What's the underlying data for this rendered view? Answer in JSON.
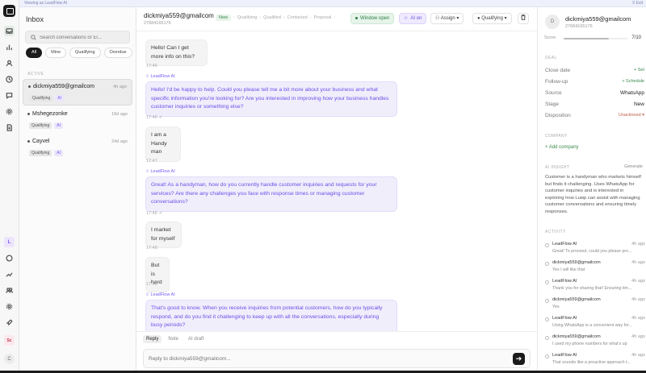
{
  "topbar": {
    "left": "Viewing as LeadFlow AI",
    "right": "X Exit"
  },
  "rail": {
    "icons": [
      "inbox-icon",
      "chart-icon",
      "users-icon",
      "clock-icon",
      "message-icon",
      "settings-icon",
      "document-icon"
    ],
    "l_badge": "L",
    "sc_badge": "Sc",
    "c_badge": "C"
  },
  "inbox": {
    "title": "Inbox",
    "search_placeholder": "Search conversations or El...",
    "filters": [
      "All",
      "Mine",
      "Qualifying",
      "Overdue"
    ],
    "section": "ACTIVE",
    "conversations": [
      {
        "name": "dickmiya559@gmailcom",
        "time": "4h ago",
        "stage": "Qualifying",
        "ai": "AI"
      },
      {
        "name": "Mshegezonke",
        "time": "18d ago",
        "stage": "Qualifying",
        "ai": "AI"
      },
      {
        "name": "Cayvel",
        "time": "24d ago",
        "stage": "Qualifying",
        "ai": "AI"
      }
    ]
  },
  "chat": {
    "email": "dickmiya559@gmailcom",
    "phone": "27684165176",
    "pipeline": [
      "New",
      "Qualifying",
      "Qualified",
      "Contacted",
      "Proposal"
    ],
    "window": "Window open",
    "ai": "AI on",
    "assign": "Assign",
    "status": "Qualifying",
    "messages": [
      {
        "dir": "in",
        "text": "Hello! Can I get more info on this?",
        "time": "17:46"
      },
      {
        "dir": "out",
        "bot": "LeadFlow AI",
        "text": "Hello! I'd be happy to help. Could you please tell me a bit more about your business and what specific information you're looking for? Are you interested in improving how your business handles customer inquiries or something else?",
        "time": "17:46"
      },
      {
        "dir": "in",
        "text": "I am a Handy man",
        "time": "17:47"
      },
      {
        "dir": "out",
        "bot": "LeadFlow AI",
        "text": "Great! As a handyman, how do you currently handle customer inquiries and requests for your services? Are there any challenges you face with response times or managing customer conversations?",
        "time": "17:48"
      },
      {
        "dir": "in",
        "text": "I market for myself",
        "time": "17:48"
      },
      {
        "dir": "in",
        "text": "But is hard",
        "time": "17:48"
      },
      {
        "dir": "out",
        "bot": "LeadFlow AI",
        "text": "That's good to know. When you receive inquiries from potential customers, how do you typically respond, and do you find it challenging to keep up with all the conversations, especially during busy periods?",
        "time": ""
      }
    ],
    "composer": {
      "tabs": [
        "Reply",
        "Note",
        "AI draft"
      ],
      "placeholder": "Reply to dickmiya559@gmailcom..."
    }
  },
  "side": {
    "avatar": "D",
    "email": "dickmiya559@gmailcom",
    "phone": "27684165176",
    "score_label": "Score",
    "score": "7/10",
    "score_fraction": 0.7,
    "deal_header": "DEAL",
    "deal": [
      {
        "k": "Close date",
        "v": "+ Set"
      },
      {
        "k": "Follow-up",
        "v": "+ Schedule"
      },
      {
        "k": "Source",
        "v": "WhatsApp"
      },
      {
        "k": "Stage",
        "v": "New"
      },
      {
        "k": "Disposition",
        "v": "Unactioned"
      }
    ],
    "company_header": "COMPANY",
    "add_company": "+ Add company",
    "insight_header": "AI INSIGHT",
    "generate": "Generate",
    "insight": "Customer is a handyman who markets himself but finds it challenging. Uses WhatsApp for customer inquiries and is interested in exploring how Luwp can assist with managing customer conversations and ensuring timely responses.",
    "activity_header": "ACTIVITY",
    "activity": [
      {
        "who": "LeadFlow AI",
        "when": "4h ago",
        "txt": "Great! To proceed, could you please pro..."
      },
      {
        "who": "dickmiya559@gmailcom",
        "when": "4h ago",
        "txt": "Yes I will like that"
      },
      {
        "who": "LeadFlow AI",
        "when": "4h ago",
        "txt": "Thank you for sharing that! Ensuring tim..."
      },
      {
        "who": "dickmiya559@gmailcom",
        "when": "4h ago",
        "txt": "Yes"
      },
      {
        "who": "LeadFlow AI",
        "when": "4h ago",
        "txt": "Using WhatsApp is a convenient way for..."
      },
      {
        "who": "dickmiya559@gmailcom",
        "when": "4h ago",
        "txt": "I used my phone numbers for what's up"
      },
      {
        "who": "LeadFlow AI",
        "when": "4h ago",
        "txt": "That sounds like a proactive approach t..."
      }
    ]
  }
}
